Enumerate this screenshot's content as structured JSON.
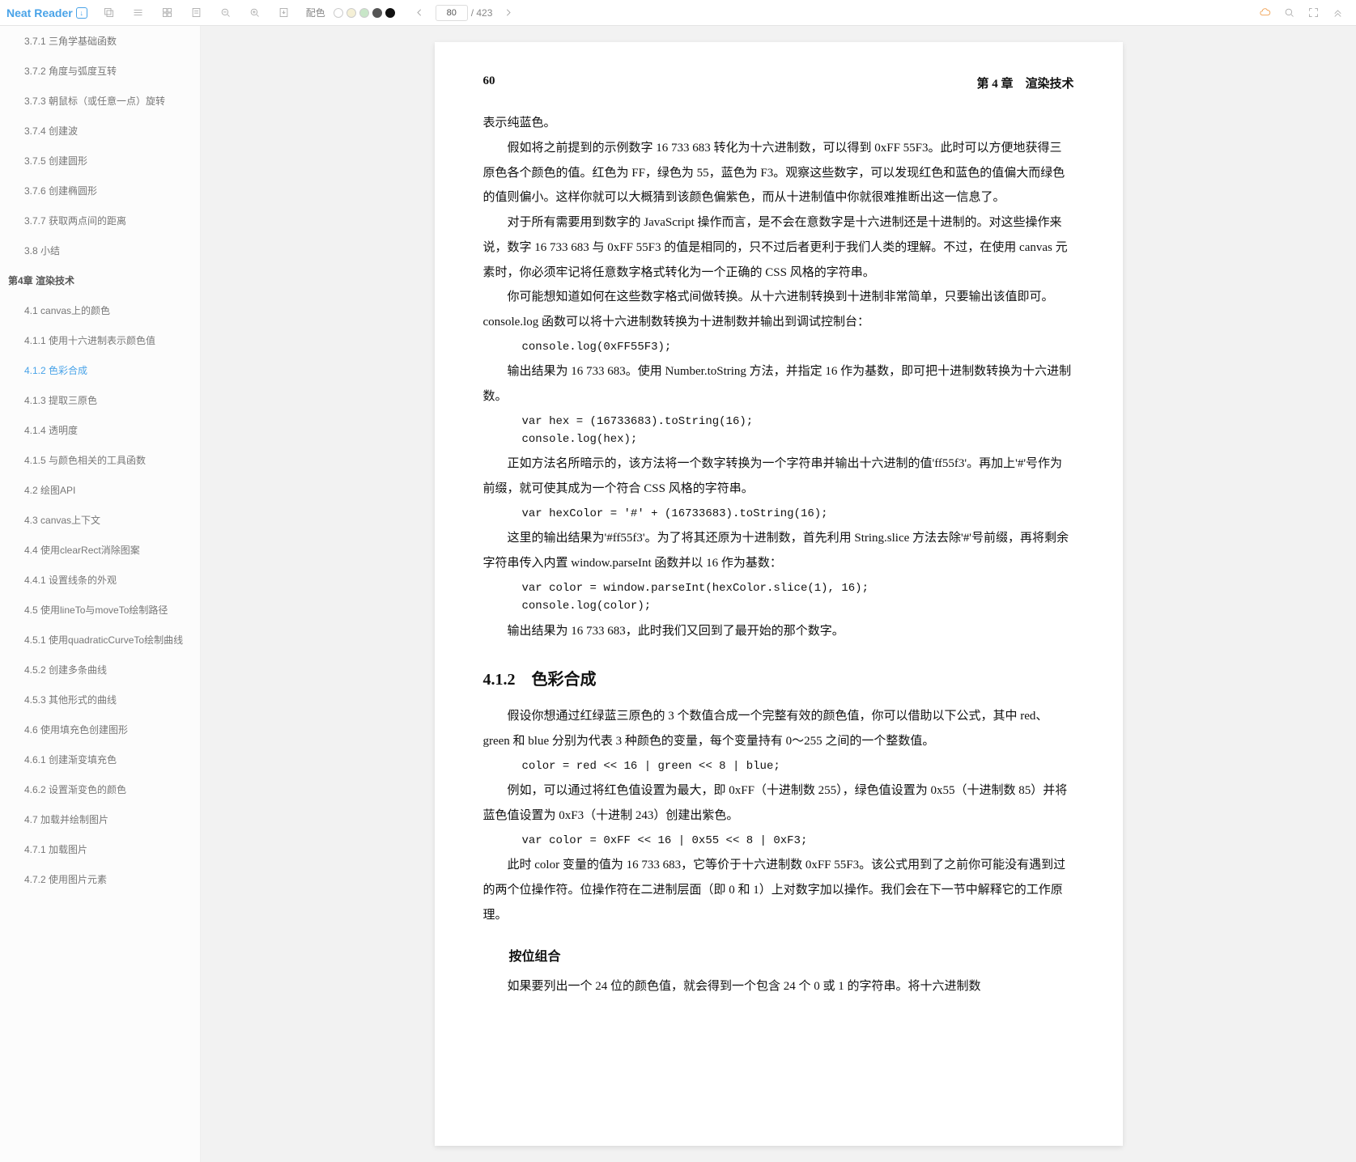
{
  "toolbar": {
    "brand": "Neat Reader",
    "palette_label": "配色",
    "page_current": "80",
    "page_total": "/ 423"
  },
  "sidebar": {
    "items": [
      {
        "label": "3.7.1 三角学基础函数",
        "level": 2,
        "active": false
      },
      {
        "label": "3.7.2 角度与弧度互转",
        "level": 2,
        "active": false
      },
      {
        "label": "3.7.3 朝鼠标（或任意一点）旋转",
        "level": 2,
        "active": false
      },
      {
        "label": "3.7.4 创建波",
        "level": 2,
        "active": false
      },
      {
        "label": "3.7.5 创建圆形",
        "level": 2,
        "active": false
      },
      {
        "label": "3.7.6 创建椭圆形",
        "level": 2,
        "active": false
      },
      {
        "label": "3.7.7 获取两点间的距离",
        "level": 2,
        "active": false
      },
      {
        "label": "3.8 小结",
        "level": 2,
        "active": false
      },
      {
        "label": "第4章 渲染技术",
        "level": 1,
        "active": false
      },
      {
        "label": "4.1 canvas上的颜色",
        "level": 2,
        "active": false
      },
      {
        "label": "4.1.1 使用十六进制表示颜色值",
        "level": 2,
        "active": false
      },
      {
        "label": "4.1.2 色彩合成",
        "level": 2,
        "active": true
      },
      {
        "label": "4.1.3 提取三原色",
        "level": 2,
        "active": false
      },
      {
        "label": "4.1.4 透明度",
        "level": 2,
        "active": false
      },
      {
        "label": "4.1.5 与颜色相关的工具函数",
        "level": 2,
        "active": false
      },
      {
        "label": "4.2 绘图API",
        "level": 2,
        "active": false
      },
      {
        "label": "4.3 canvas上下文",
        "level": 2,
        "active": false
      },
      {
        "label": "4.4 使用clearRect消除图案",
        "level": 2,
        "active": false
      },
      {
        "label": "4.4.1 设置线条的外观",
        "level": 2,
        "active": false
      },
      {
        "label": "4.5 使用lineTo与moveTo绘制路径",
        "level": 2,
        "active": false
      },
      {
        "label": "4.5.1 使用quadraticCurveTo绘制曲线",
        "level": 2,
        "active": false
      },
      {
        "label": "4.5.2 创建多条曲线",
        "level": 2,
        "active": false
      },
      {
        "label": "4.5.3 其他形式的曲线",
        "level": 2,
        "active": false
      },
      {
        "label": "4.6 使用填充色创建图形",
        "level": 2,
        "active": false
      },
      {
        "label": "4.6.1 创建渐变填充色",
        "level": 2,
        "active": false
      },
      {
        "label": "4.6.2 设置渐变色的颜色",
        "level": 2,
        "active": false
      },
      {
        "label": "4.7 加载并绘制图片",
        "level": 2,
        "active": false
      },
      {
        "label": "4.7.1 加载图片",
        "level": 2,
        "active": false
      },
      {
        "label": "4.7.2 使用图片元素",
        "level": 2,
        "active": false
      }
    ]
  },
  "content": {
    "page_number": "60",
    "chapter_header": "第 4 章　渲染技术",
    "blocks": [
      {
        "t": "p_noindent",
        "v": "表示纯蓝色。"
      },
      {
        "t": "p",
        "v": "假如将之前提到的示例数字 16 733 683 转化为十六进制数，可以得到 0xFF 55F3。此时可以方便地获得三原色各个颜色的值。红色为 FF，绿色为 55，蓝色为 F3。观察这些数字，可以发现红色和蓝色的值偏大而绿色的值则偏小。这样你就可以大概猜到该颜色偏紫色，而从十进制值中你就很难推断出这一信息了。"
      },
      {
        "t": "p",
        "v": "对于所有需要用到数字的 JavaScript 操作而言，是不会在意数字是十六进制还是十进制的。对这些操作来说，数字 16 733 683 与 0xFF 55F3 的值是相同的，只不过后者更利于我们人类的理解。不过，在使用 canvas 元素时，你必须牢记将任意数字格式转化为一个正确的 CSS 风格的字符串。"
      },
      {
        "t": "p",
        "v": "你可能想知道如何在这些数字格式间做转换。从十六进制转换到十进制非常简单，只要输出该值即可。console.log 函数可以将十六进制数转换为十进制数并输出到调试控制台："
      },
      {
        "t": "pre",
        "v": "console.log(0xFF55F3);"
      },
      {
        "t": "p",
        "v": "输出结果为 16 733 683。使用 Number.toString 方法，并指定 16 作为基数，即可把十进制数转换为十六进制数。"
      },
      {
        "t": "pre",
        "v": "var hex = (16733683).toString(16);\nconsole.log(hex);"
      },
      {
        "t": "p",
        "v": "正如方法名所暗示的，该方法将一个数字转换为一个字符串并输出十六进制的值'ff55f3'。再加上'#'号作为前缀，就可使其成为一个符合 CSS 风格的字符串。"
      },
      {
        "t": "pre",
        "v": "var hexColor = '#' + (16733683).toString(16);"
      },
      {
        "t": "p",
        "v": "这里的输出结果为'#ff55f3'。为了将其还原为十进制数，首先利用 String.slice 方法去除'#'号前缀，再将剩余字符串传入内置 window.parseInt 函数并以 16 作为基数："
      },
      {
        "t": "pre",
        "v": "var color = window.parseInt(hexColor.slice(1), 16);\nconsole.log(color);"
      },
      {
        "t": "p",
        "v": "输出结果为 16 733 683，此时我们又回到了最开始的那个数字。"
      },
      {
        "t": "h3",
        "v": "4.1.2　色彩合成"
      },
      {
        "t": "p",
        "v": "假设你想通过红绿蓝三原色的 3 个数值合成一个完整有效的颜色值，你可以借助以下公式，其中 red、green 和 blue 分别为代表 3 种颜色的变量，每个变量持有 0～255 之间的一个整数值。"
      },
      {
        "t": "pre",
        "v": "color = red << 16 | green << 8 | blue;"
      },
      {
        "t": "p",
        "v": "例如，可以通过将红色值设置为最大，即 0xFF（十进制数 255），绿色值设置为 0x55（十进制数 85）并将蓝色值设置为 0xF3（十进制 243）创建出紫色。"
      },
      {
        "t": "pre",
        "v": "var color = 0xFF << 16 | 0x55 << 8 | 0xF3;"
      },
      {
        "t": "p",
        "v": "此时 color 变量的值为 16 733 683，它等价于十六进制数 0xFF 55F3。该公式用到了之前你可能没有遇到过的两个位操作符。位操作符在二进制层面（即 0 和 1）上对数字加以操作。我们会在下一节中解释它的工作原理。"
      },
      {
        "t": "h4",
        "v": "按位组合"
      },
      {
        "t": "p",
        "v": "如果要列出一个 24 位的颜色值，就会得到一个包含 24 个 0 或 1 的字符串。将十六进制数"
      }
    ]
  }
}
